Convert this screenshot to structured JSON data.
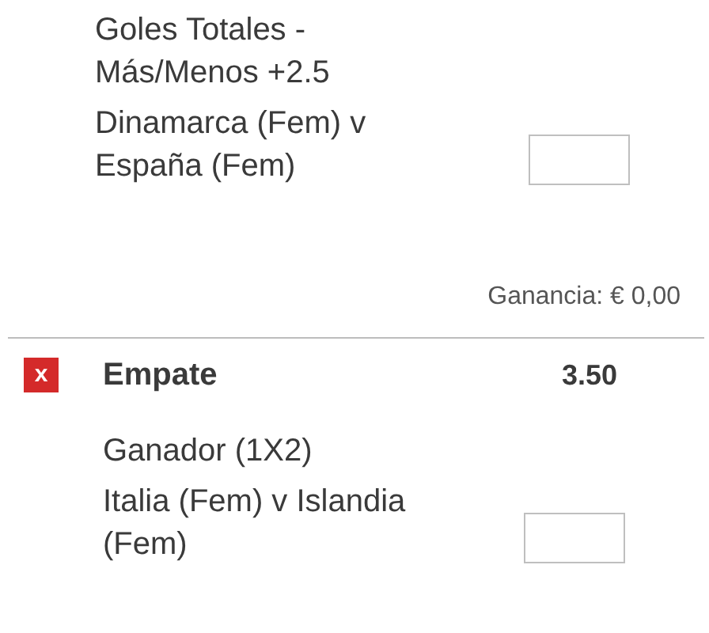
{
  "bets": [
    {
      "market": "Goles Totales - Más/Menos +2.5",
      "event": "Dinamarca (Fem) v España (Fem)",
      "profit": "Ganancia: € 0,00"
    },
    {
      "remove": "x",
      "selection": "Empate",
      "odds": "3.50",
      "market": "Ganador (1X2)",
      "event": "Italia (Fem) v Islandia (Fem)"
    }
  ]
}
